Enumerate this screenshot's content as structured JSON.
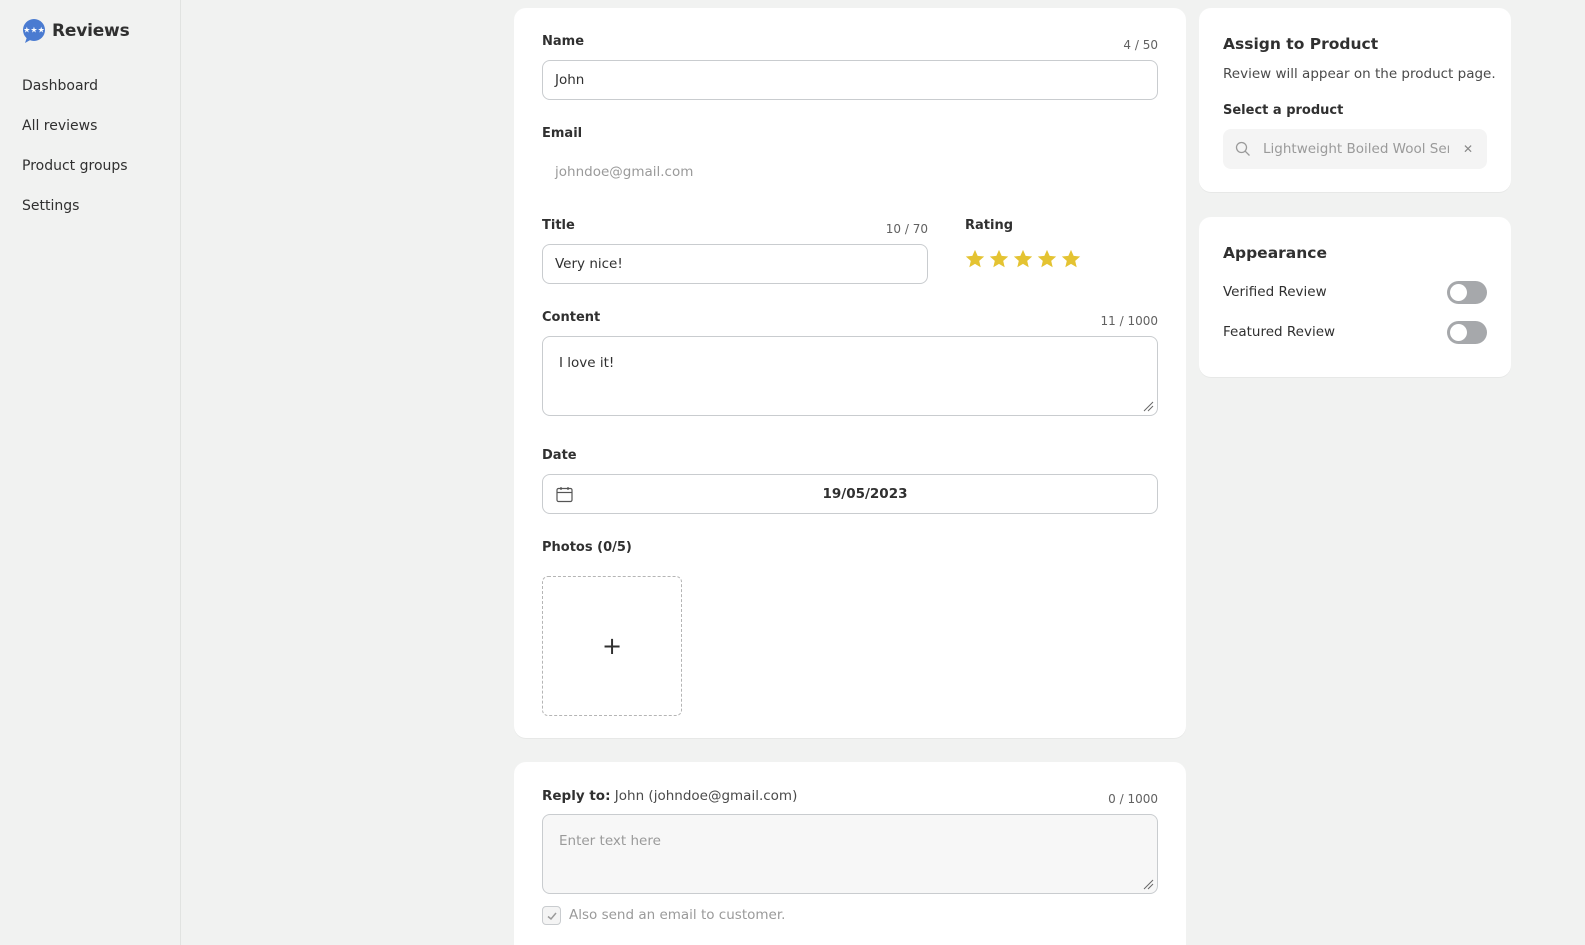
{
  "app": {
    "name": "Reviews",
    "accent": "#4a7bd1"
  },
  "sidebar": {
    "items": [
      {
        "label": "Dashboard"
      },
      {
        "label": "All reviews"
      },
      {
        "label": "Product groups"
      },
      {
        "label": "Settings"
      }
    ]
  },
  "form": {
    "name": {
      "label": "Name",
      "value": "John",
      "counter": "4 / 50"
    },
    "email": {
      "label": "Email",
      "value": "johndoe@gmail.com"
    },
    "title": {
      "label": "Title",
      "value": "Very nice!",
      "counter": "10 / 70"
    },
    "rating": {
      "label": "Rating",
      "value": 5,
      "max": 5,
      "color": "#e4c332"
    },
    "content": {
      "label": "Content",
      "value": "I love it!",
      "counter": "11 / 1000"
    },
    "date": {
      "label": "Date",
      "value": "19/05/2023"
    },
    "photos": {
      "label": "Photos (0/5)",
      "add_symbol": "+"
    }
  },
  "reply": {
    "label_prefix": "Reply to:",
    "recipient": "John (johndoe@gmail.com)",
    "counter": "0 / 1000",
    "placeholder": "Enter text here",
    "email_checkbox_label": "Also send an email to customer.",
    "email_checkbox_checked": true
  },
  "assign": {
    "title": "Assign to Product",
    "description": "Review will appear on the product page.",
    "select_label": "Select a product",
    "selected_product": "Lightweight Boiled Wool Serape",
    "clear_symbol": "✕"
  },
  "appearance": {
    "title": "Appearance",
    "toggles": [
      {
        "label": "Verified Review",
        "on": false
      },
      {
        "label": "Featured Review",
        "on": false
      }
    ]
  }
}
